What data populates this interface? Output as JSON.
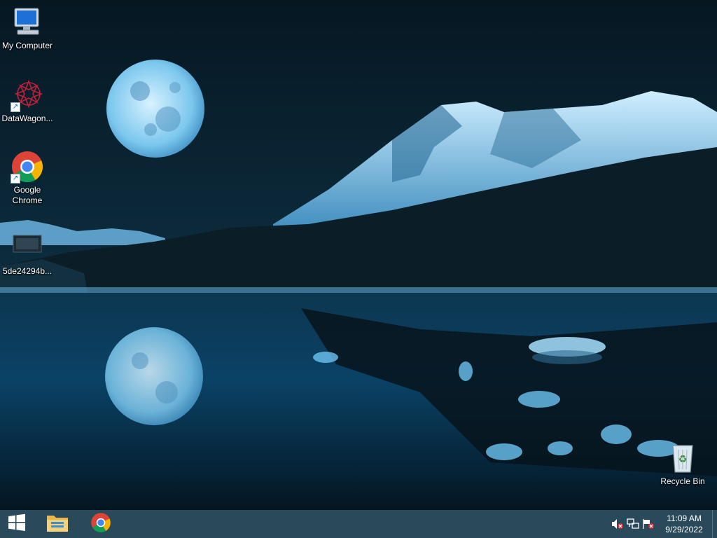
{
  "desktop": {
    "icons": [
      {
        "label": "My Computer",
        "icon": "computer-icon"
      },
      {
        "label": "DataWagon...",
        "icon": "datawagon-icon"
      },
      {
        "label": "Google Chrome",
        "icon": "chrome-icon"
      },
      {
        "label": "5de24294b...",
        "icon": "file-thumbnail-icon"
      },
      {
        "label": "Recycle Bin",
        "icon": "recycle-bin-icon"
      }
    ]
  },
  "taskbar": {
    "start_icon": "windows-start-icon",
    "pinned": [
      {
        "icon": "file-explorer-icon"
      },
      {
        "icon": "chrome-icon"
      }
    ],
    "tray": {
      "icons": [
        "volume-muted-icon",
        "network-icon",
        "action-center-icon"
      ],
      "time": "11:09 AM",
      "date": "9/29/2022"
    }
  },
  "colors": {
    "taskbar_bg": "#2a4a5c",
    "wallpaper_sky": "#0a2232",
    "accent_blue": "#4fa8e0"
  }
}
